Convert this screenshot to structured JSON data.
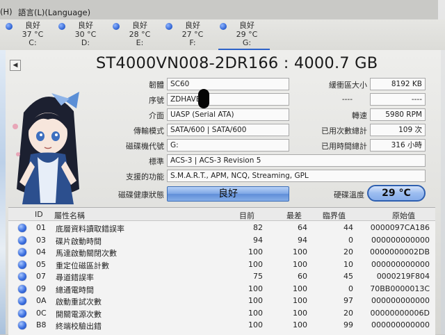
{
  "menu": {
    "partial": "(H)",
    "language": "語言(L)(Language)"
  },
  "drives": [
    {
      "status": "良好",
      "temp": "37 °C",
      "letter": "C:"
    },
    {
      "status": "良好",
      "temp": "30 °C",
      "letter": "D:"
    },
    {
      "status": "良好",
      "temp": "28 °C",
      "letter": "E:"
    },
    {
      "status": "良好",
      "temp": "27 °C",
      "letter": "F:"
    },
    {
      "status": "良好",
      "temp": "29 °C",
      "letter": "G:"
    }
  ],
  "title": "ST4000VN008-2DR166 : 4000.7 GB",
  "info": {
    "firmware_label": "韌體",
    "firmware": "SC60",
    "serial_label": "序號",
    "serial": "ZDHAVE",
    "interface_label": "介面",
    "interface": "UASP (Serial ATA)",
    "transfer_label": "傳輸模式",
    "transfer": "SATA/600 | SATA/600",
    "drive_letter_label": "磁碟機代號",
    "drive_letter": "G:",
    "standard_label": "標準",
    "standard": "ACS-3 | ACS-3 Revision 5",
    "features_label": "支援的功能",
    "features": "S.M.A.R.T., APM, NCQ, Streaming, GPL",
    "health_label": "磁碟健康狀態",
    "health": "良好",
    "buffer_label": "緩衝區大小",
    "buffer": "8192 KB",
    "blank1": "----",
    "blank2": "----",
    "rotation_label": "轉速",
    "rotation": "5980 RPM",
    "power_count_label": "已用次數總計",
    "power_count": "109 次",
    "power_hours_label": "已用時間總計",
    "power_hours": "316 小時",
    "temp_label": "硬碟溫度",
    "temp": "29 °C"
  },
  "smart": {
    "headers": {
      "id": "ID",
      "name": "屬性名稱",
      "current": "目前",
      "worst": "最差",
      "threshold": "臨界值",
      "raw": "原始值"
    },
    "rows": [
      {
        "id": "01",
        "name": "底層資料讀取錯誤率",
        "current": "82",
        "worst": "64",
        "threshold": "44",
        "raw": "0000097CA186"
      },
      {
        "id": "03",
        "name": "碟片啟動時間",
        "current": "94",
        "worst": "94",
        "threshold": "0",
        "raw": "000000000000"
      },
      {
        "id": "04",
        "name": "馬達啟動關閉次數",
        "current": "100",
        "worst": "100",
        "threshold": "20",
        "raw": "0000000002DB"
      },
      {
        "id": "05",
        "name": "重定位磁區計數",
        "current": "100",
        "worst": "100",
        "threshold": "10",
        "raw": "000000000000"
      },
      {
        "id": "07",
        "name": "尋道錯誤率",
        "current": "75",
        "worst": "60",
        "threshold": "45",
        "raw": "0000219F804"
      },
      {
        "id": "09",
        "name": "總通電時間",
        "current": "100",
        "worst": "100",
        "threshold": "0",
        "raw": "70BB0000013C"
      },
      {
        "id": "0A",
        "name": "啟動重試次數",
        "current": "100",
        "worst": "100",
        "threshold": "97",
        "raw": "000000000000"
      },
      {
        "id": "0C",
        "name": "開關電源次數",
        "current": "100",
        "worst": "100",
        "threshold": "20",
        "raw": "00000000006D"
      },
      {
        "id": "B8",
        "name": "終端校驗出錯",
        "current": "100",
        "worst": "100",
        "threshold": "99",
        "raw": "000000000000"
      }
    ]
  }
}
